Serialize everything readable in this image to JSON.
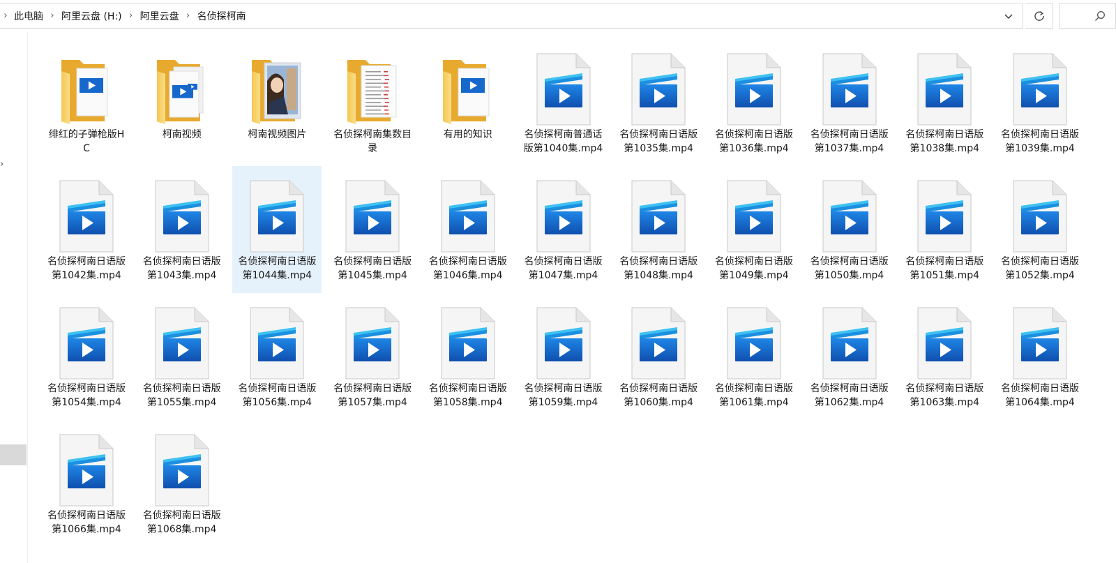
{
  "address_bar": {
    "breadcrumbs": [
      "此电脑",
      "阿里云盘 (H:)",
      "阿里云盘",
      "名侦探柯南"
    ]
  },
  "icons": {
    "dropdown": "chevron-down-icon",
    "refresh": "refresh-icon",
    "search": "search-icon",
    "folder": "folder-icon",
    "video": "video-file-icon"
  },
  "colors": {
    "folder": "#f4c24e",
    "video_blue": "#1a6fd1",
    "selection": "#e5f1fb"
  },
  "items": [
    {
      "label": "绯红的子弹枪版HC",
      "type": "folder",
      "thumb": "video"
    },
    {
      "label": "柯南视频",
      "type": "folder",
      "thumb": "video2"
    },
    {
      "label": "柯南视频图片",
      "type": "folder",
      "thumb": "picture"
    },
    {
      "label": "名侦探柯南集数目录",
      "type": "folder",
      "thumb": "doc"
    },
    {
      "label": "有用的知识",
      "type": "folder",
      "thumb": "video"
    },
    {
      "label": "名侦探柯南普通话版第1040集.mp4",
      "type": "video"
    },
    {
      "label": "名侦探柯南日语版第1035集.mp4",
      "type": "video"
    },
    {
      "label": "名侦探柯南日语版第1036集.mp4",
      "type": "video"
    },
    {
      "label": "名侦探柯南日语版第1037集.mp4",
      "type": "video"
    },
    {
      "label": "名侦探柯南日语版第1038集.mp4",
      "type": "video"
    },
    {
      "label": "名侦探柯南日语版第1039集.mp4",
      "type": "video"
    },
    {
      "label": "名侦探柯南日语版第1042集.mp4",
      "type": "video"
    },
    {
      "label": "名侦探柯南日语版第1043集.mp4",
      "type": "video"
    },
    {
      "label": "名侦探柯南日语版第1044集.mp4",
      "type": "video",
      "selected": true
    },
    {
      "label": "名侦探柯南日语版第1045集.mp4",
      "type": "video"
    },
    {
      "label": "名侦探柯南日语版第1046集.mp4",
      "type": "video"
    },
    {
      "label": "名侦探柯南日语版第1047集.mp4",
      "type": "video"
    },
    {
      "label": "名侦探柯南日语版第1048集.mp4",
      "type": "video"
    },
    {
      "label": "名侦探柯南日语版第1049集.mp4",
      "type": "video"
    },
    {
      "label": "名侦探柯南日语版第1050集.mp4",
      "type": "video"
    },
    {
      "label": "名侦探柯南日语版第1051集.mp4",
      "type": "video"
    },
    {
      "label": "名侦探柯南日语版第1052集.mp4",
      "type": "video"
    },
    {
      "label": "名侦探柯南日语版第1054集.mp4",
      "type": "video"
    },
    {
      "label": "名侦探柯南日语版第1055集.mp4",
      "type": "video"
    },
    {
      "label": "名侦探柯南日语版第1056集.mp4",
      "type": "video"
    },
    {
      "label": "名侦探柯南日语版第1057集.mp4",
      "type": "video"
    },
    {
      "label": "名侦探柯南日语版第1058集.mp4",
      "type": "video"
    },
    {
      "label": "名侦探柯南日语版第1059集.mp4",
      "type": "video"
    },
    {
      "label": "名侦探柯南日语版第1060集.mp4",
      "type": "video"
    },
    {
      "label": "名侦探柯南日语版第1061集.mp4",
      "type": "video"
    },
    {
      "label": "名侦探柯南日语版第1062集.mp4",
      "type": "video"
    },
    {
      "label": "名侦探柯南日语版第1063集.mp4",
      "type": "video"
    },
    {
      "label": "名侦探柯南日语版第1064集.mp4",
      "type": "video"
    },
    {
      "label": "名侦探柯南日语版第1066集.mp4",
      "type": "video"
    },
    {
      "label": "名侦探柯南日语版第1068集.mp4",
      "type": "video"
    }
  ]
}
